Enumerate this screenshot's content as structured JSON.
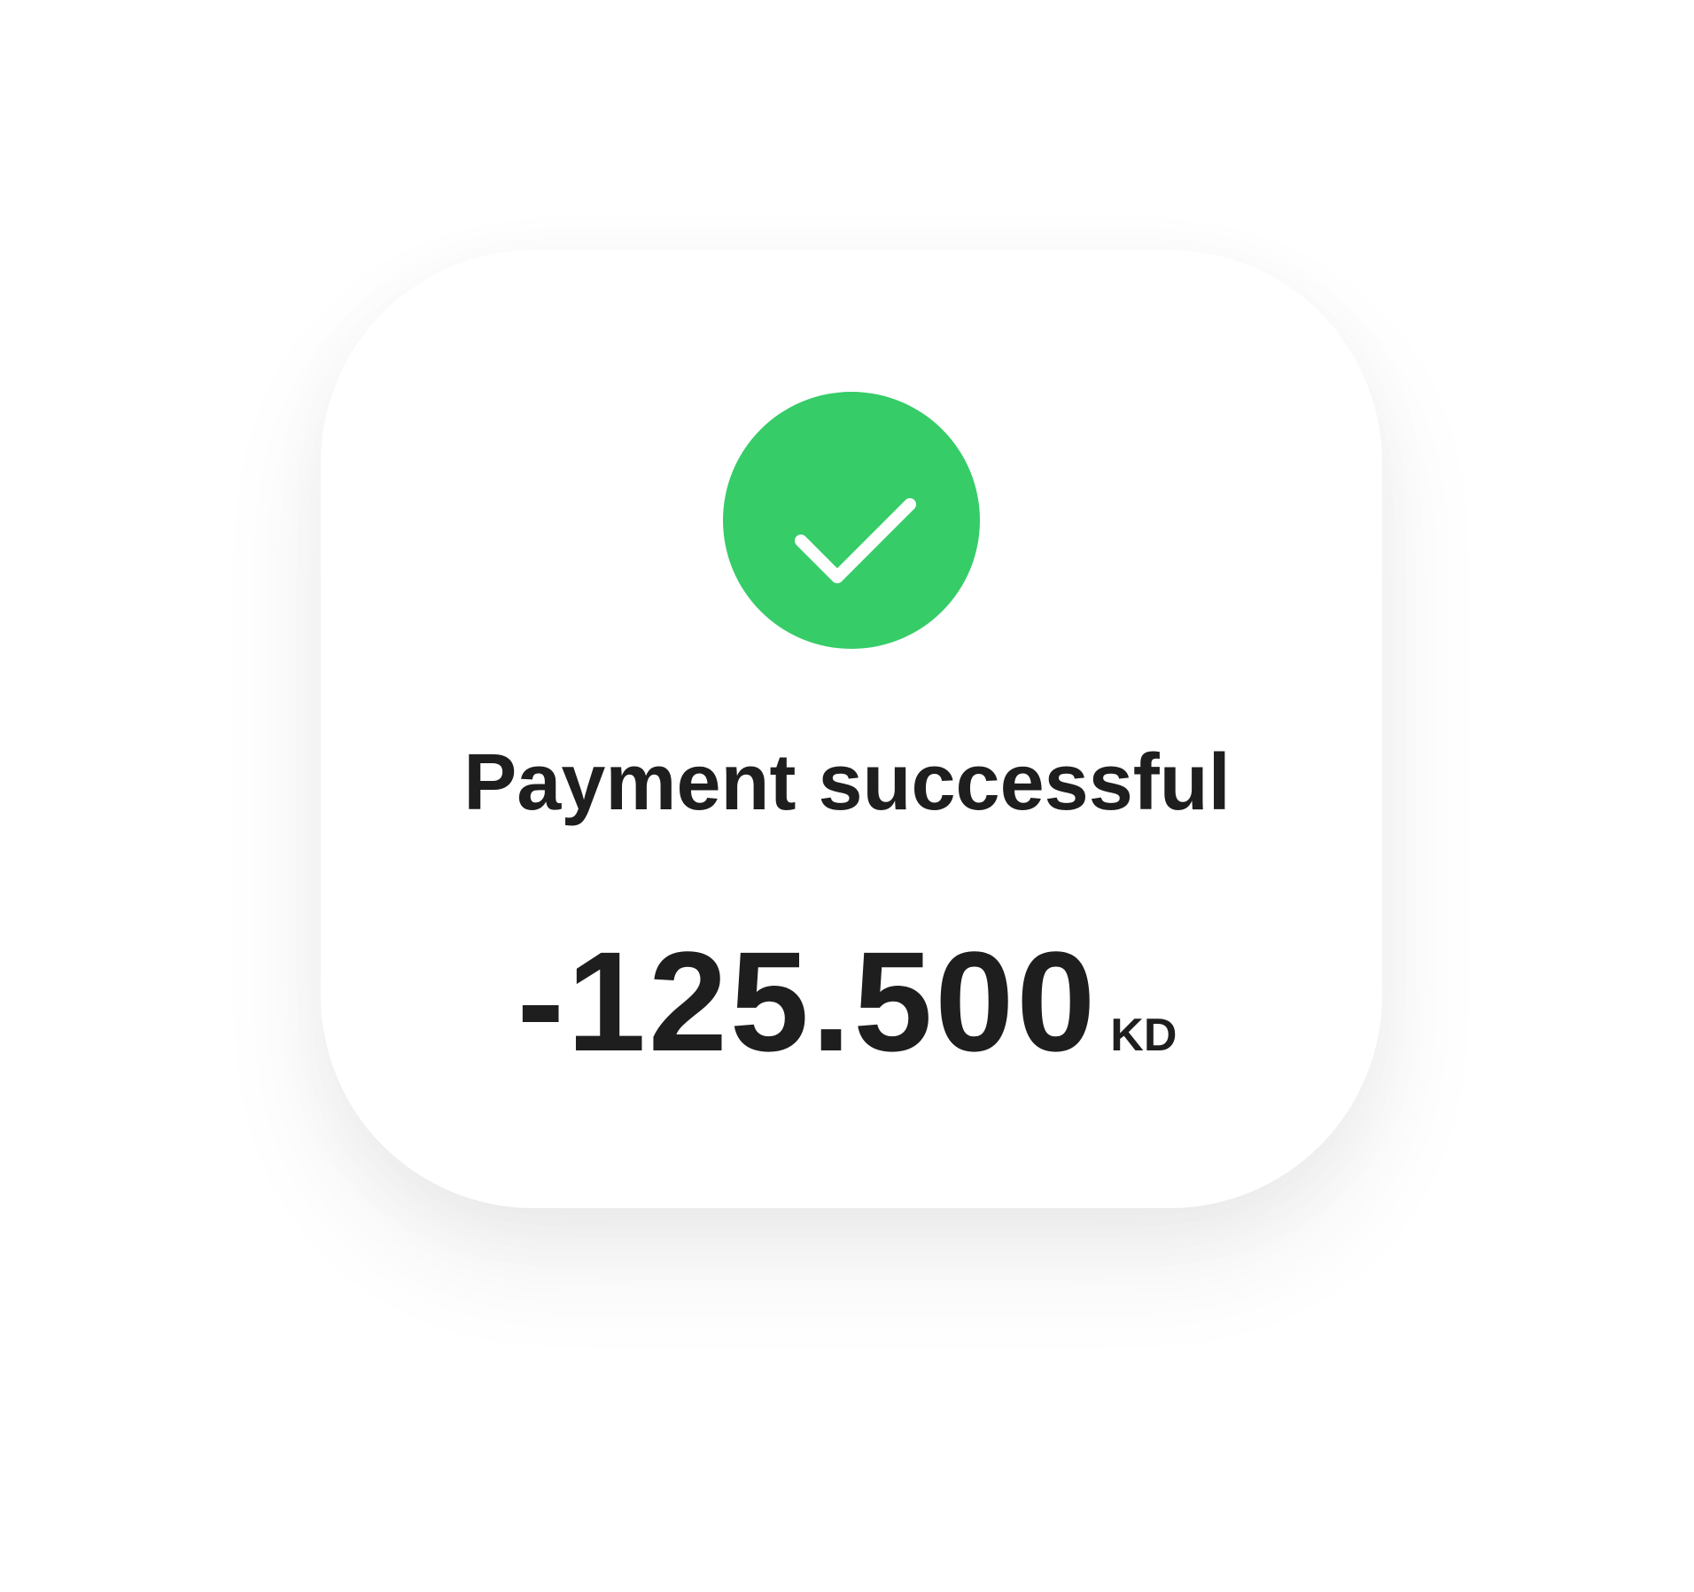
{
  "colors": {
    "success": "#36CC68",
    "text": "#1E1E1E",
    "card": "#FFFFFF"
  },
  "icon": "check-circle-icon",
  "title": "Payment successful",
  "amount": {
    "value": "-125.500",
    "currency": "KD"
  }
}
